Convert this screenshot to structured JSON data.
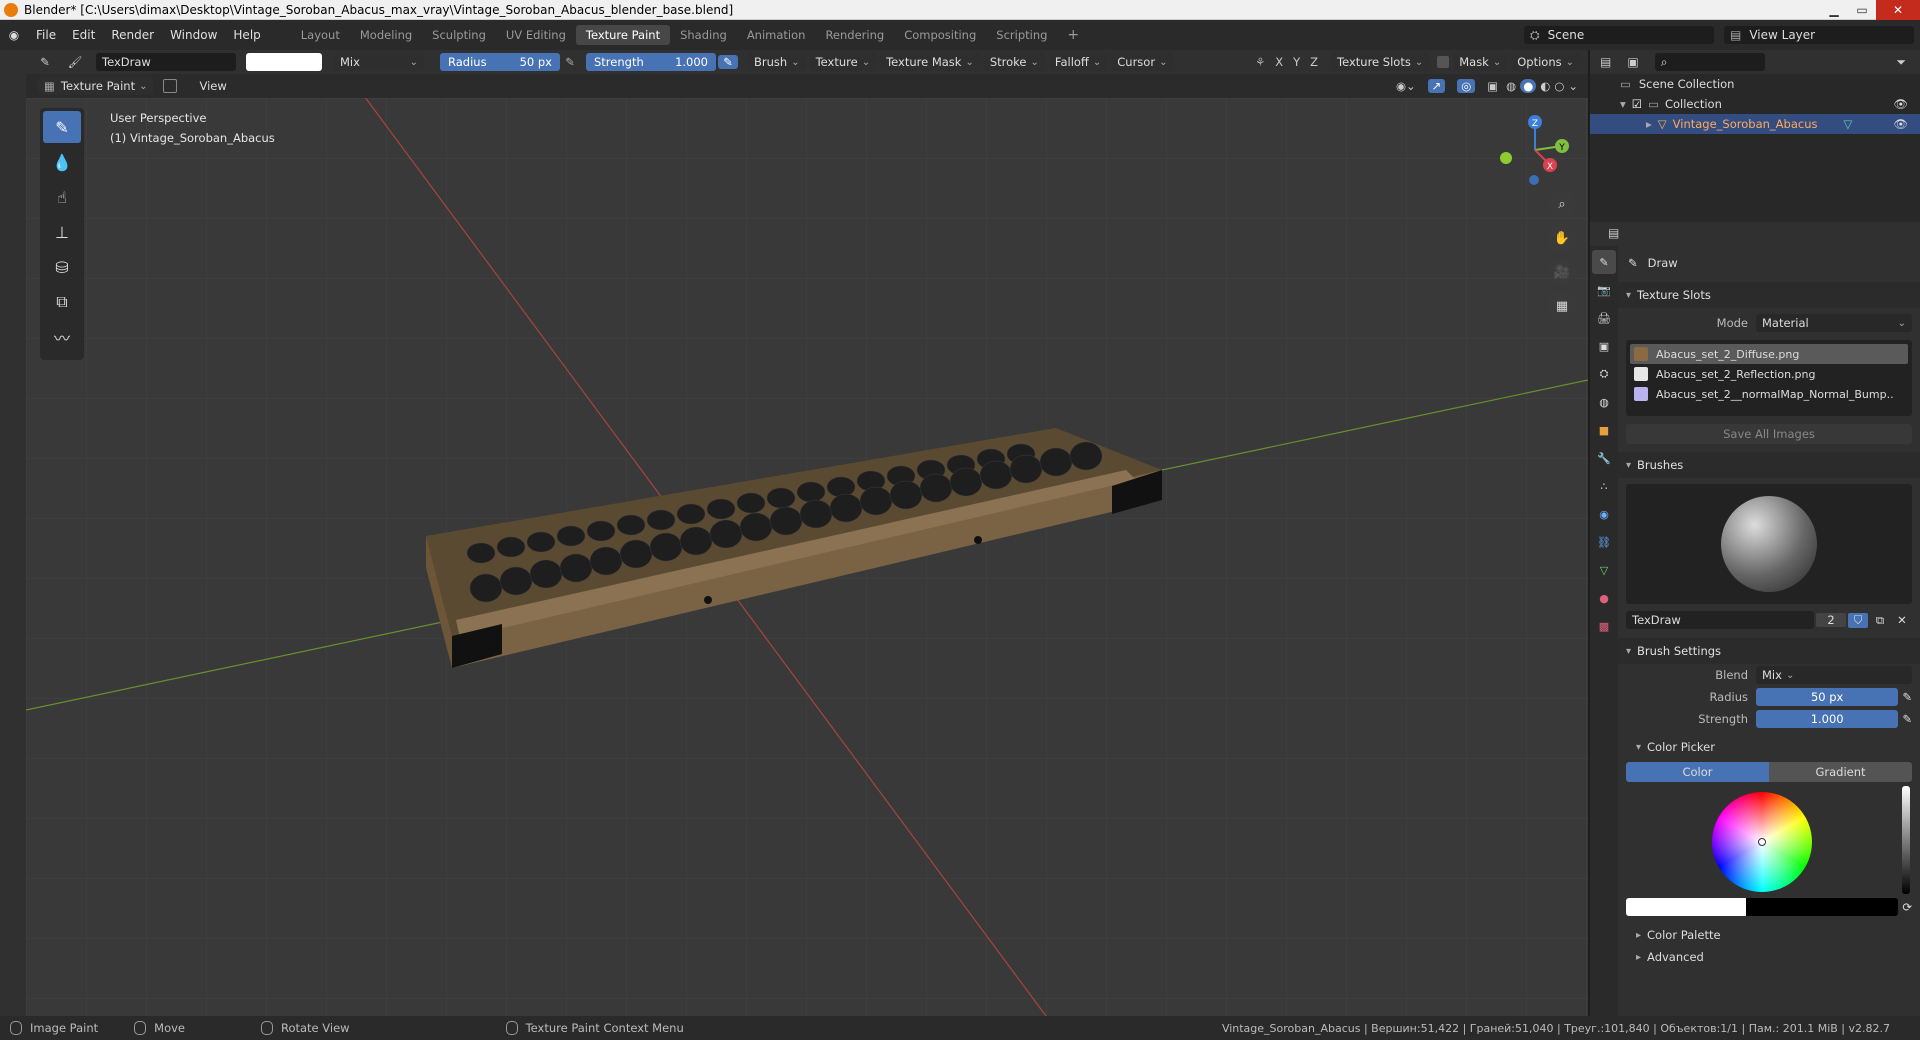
{
  "window": {
    "title": "Blender* [C:\\Users\\dimax\\Desktop\\Vintage_Soroban_Abacus_max_vray\\Vintage_Soroban_Abacus_blender_base.blend]"
  },
  "menu": [
    "File",
    "Edit",
    "Render",
    "Window",
    "Help"
  ],
  "workspaces": [
    "Layout",
    "Modeling",
    "Sculpting",
    "UV Editing",
    "Texture Paint",
    "Shading",
    "Animation",
    "Rendering",
    "Compositing",
    "Scripting"
  ],
  "workspace_active": "Texture Paint",
  "scene": {
    "label": "Scene",
    "view_layer": "View Layer"
  },
  "tool_header": {
    "brush_name": "TexDraw",
    "blend": "Mix",
    "radius_label": "Radius",
    "radius_value": "50 px",
    "strength_label": "Strength",
    "strength_value": "1.000",
    "menus": [
      "Brush",
      "Texture",
      "Texture Mask",
      "Stroke",
      "Falloff",
      "Cursor"
    ],
    "axes": [
      "X",
      "Y",
      "Z"
    ],
    "texture_slots": "Texture Slots",
    "mask": "Mask",
    "options": "Options"
  },
  "mode_header": {
    "mode": "Texture Paint",
    "view": "View"
  },
  "viewport": {
    "perspective": "User Perspective",
    "object": "(1) Vintage_Soroban_Abacus",
    "gizmo_axes": [
      "X",
      "Y",
      "Z"
    ]
  },
  "outliner": {
    "root": "Scene Collection",
    "collection": "Collection",
    "object": "Vintage_Soroban_Abacus"
  },
  "properties": {
    "tool_name": "Draw",
    "texture_slots": {
      "title": "Texture Slots",
      "mode_label": "Mode",
      "mode_value": "Material",
      "slots": [
        "Abacus_set_2_Diffuse.png",
        "Abacus_set_2_Reflection.png",
        "Abacus_set_2__normalMap_Normal_Bump.."
      ],
      "save_all": "Save All Images"
    },
    "brushes": {
      "title": "Brushes",
      "brush_name": "TexDraw",
      "users": "2"
    },
    "brush_settings": {
      "title": "Brush Settings",
      "blend_label": "Blend",
      "blend_value": "Mix",
      "radius_label": "Radius",
      "radius_value": "50 px",
      "strength_label": "Strength",
      "strength_value": "1.000"
    },
    "color_picker": {
      "title": "Color Picker",
      "tab_color": "Color",
      "tab_gradient": "Gradient"
    },
    "color_palette": "Color Palette",
    "advanced": "Advanced"
  },
  "statusbar": {
    "items": [
      "Image Paint",
      "Move",
      "Rotate View",
      "Texture Paint Context Menu"
    ],
    "stats": "Vintage_Soroban_Abacus | Вершин:51,422 | Граней:51,040 | Треуг.:101,840 | Объектов:1/1 | Пам.: 201.1 MiB | v2.82.7"
  },
  "colors": {
    "accent": "#4772b3",
    "selection": "#334d80",
    "orange": "#e87d0d"
  }
}
